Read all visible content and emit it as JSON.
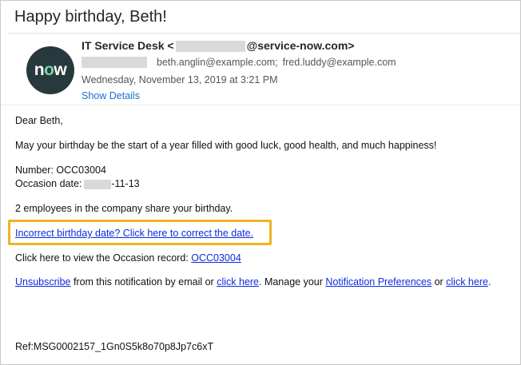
{
  "email": {
    "subject": "Happy birthday, Beth!",
    "avatar_text_prefix": "n",
    "avatar_text_o": "o",
    "avatar_text_suffix": "w",
    "sender_name": "IT Service Desk <",
    "sender_domain": "@service-now.com>",
    "recipient_1": "beth.anglin@example.com;",
    "recipient_2": "fred.luddy@example.com",
    "date": "Wednesday, November 13, 2019 at 3:21 PM",
    "show_details": "Show Details"
  },
  "body": {
    "greeting": "Dear Beth,",
    "wish": "May your birthday be the start of a year filled with good luck, good health, and much happiness!",
    "number_label": "Number: OCC03004",
    "occasion_label": "Occasion date:",
    "occasion_suffix": "-11-13",
    "share": "2 employees in the company share your birthday.",
    "correct_link": "Incorrect birthday date? Click here to correct the date.",
    "view_text": "Click here to view the Occasion record: ",
    "record_link": "OCC03004",
    "unsubscribe_link": "Unsubscribe",
    "unsub_text_1": " from this notification by email or ",
    "click_here_1": "click here",
    "unsub_text_2": ". Manage your ",
    "notif_prefs_link": "Notification Preferences",
    "unsub_text_3": " or ",
    "click_here_2": "click here",
    "unsub_text_4": ".",
    "ref": "Ref:MSG0002157_1Gn0S5k8o70p8Jp7c6xT"
  },
  "colors": {
    "highlight_border": "#f0b322",
    "link": "#0b2de0",
    "show_details": "#1a6fd1",
    "avatar_bg": "#27393d",
    "avatar_accent": "#7ad6a6"
  }
}
